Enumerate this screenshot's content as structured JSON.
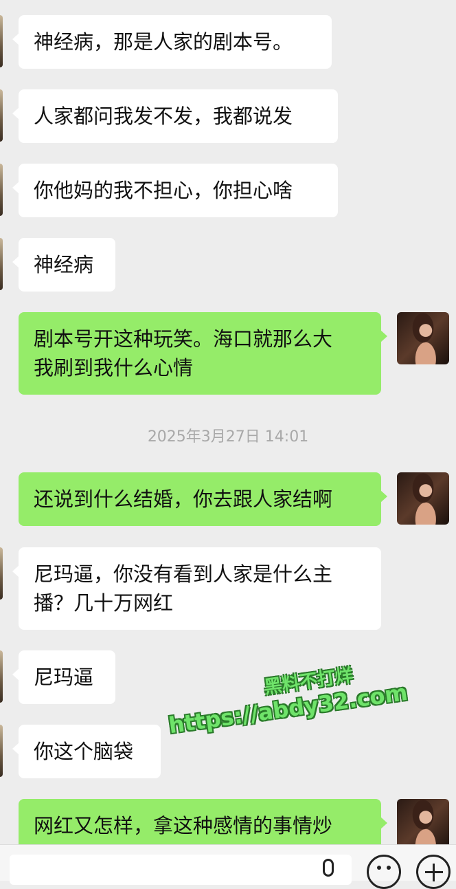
{
  "messages": [
    {
      "side": "in",
      "text": "神经病，那是人家的剧本号。"
    },
    {
      "side": "in",
      "text": "人家都问我发不发，我都说发"
    },
    {
      "side": "in",
      "text": "你他妈的我不担心，你担心啥"
    },
    {
      "side": "in",
      "text": "神经病"
    },
    {
      "side": "out",
      "text": "剧本号开这种玩笑。海口就那么大\n我刷到我什么心情"
    },
    {
      "side": "out",
      "text": "还说到什么结婚，你去跟人家结啊"
    },
    {
      "side": "in",
      "text": "尼玛逼，你没有看到人家是什么主\n播？几十万网红"
    },
    {
      "side": "in",
      "text": "尼玛逼"
    },
    {
      "side": "in",
      "text": "你这个脑袋"
    },
    {
      "side": "out",
      "text": "网红又怎样，拿这种感情的事情炒\n作，你没有考虑过我的感受"
    }
  ],
  "timestamp": "2025年3月27日 14:01",
  "watermark": {
    "line1": "黑料不打烊",
    "line2": "https://abdy32.com"
  },
  "bottom_bar": {
    "input_value": "",
    "icons": [
      "microphone-icon",
      "emoji-icon",
      "plus-icon"
    ]
  },
  "colors": {
    "background": "#ededed",
    "incoming_bubble": "#ffffff",
    "outgoing_bubble": "#95ec69",
    "timestamp_text": "#a8a8a8"
  }
}
